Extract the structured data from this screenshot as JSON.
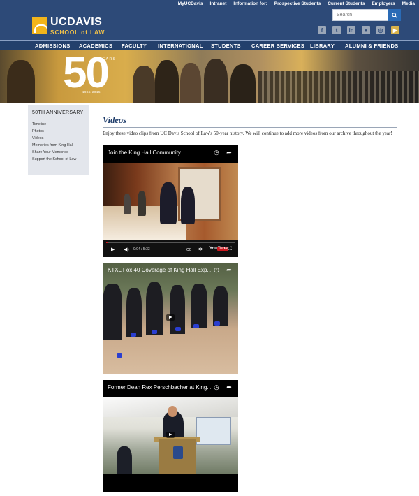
{
  "utility_nav": {
    "myucdavis": "MyUCDavis",
    "intranet": "Intranet",
    "information_for": "Information for:",
    "prospective": "Prospective Students",
    "current": "Current Students",
    "employers": "Employers",
    "media": "Media"
  },
  "logo": {
    "uc": "UCDAVIS",
    "school": "SCHOOL of LAW"
  },
  "search": {
    "placeholder": "Search"
  },
  "social_icons": [
    "facebook-icon",
    "twitter-icon",
    "linkedin-icon",
    "flickr-icon",
    "instagram-icon",
    "youtube-icon"
  ],
  "nav": {
    "items": [
      "ADMISSIONS",
      "ACADEMICS",
      "FACULTY",
      "INTERNATIONAL",
      "STUDENTS",
      "CAREER SERVICES",
      "LIBRARY",
      "ALUMNI & FRIENDS"
    ]
  },
  "banner": {
    "number": "50",
    "years": "YEARS",
    "dates": "1965-2015"
  },
  "sidebar": {
    "title": "50TH ANNIVERSARY",
    "items": [
      {
        "label": "Timeline"
      },
      {
        "label": "Photos"
      },
      {
        "label": "Videos"
      },
      {
        "label": "Memories from King Hall"
      },
      {
        "label": "Share Your Memories"
      },
      {
        "label": "Support the School of Law"
      }
    ]
  },
  "main": {
    "title": "Videos",
    "intro": "Enjoy these video clips from UC Davis School of Law's 50-year history. We will continue to add more videos from our archive throughout the year!"
  },
  "videos": [
    {
      "title": "Join the King Hall Community",
      "time": "0:04 / 5:33",
      "progress": 0.012
    },
    {
      "title": "KTXL Fox 40 Coverage of King Hall Exp..."
    },
    {
      "title": "Former Dean Rex Perschbacher at King..."
    }
  ],
  "colors": {
    "header_bg": "#2d4a78",
    "nav_bg": "#23406c",
    "accent_gold": "#f2b51b",
    "title_blue": "#1e3c6a"
  }
}
